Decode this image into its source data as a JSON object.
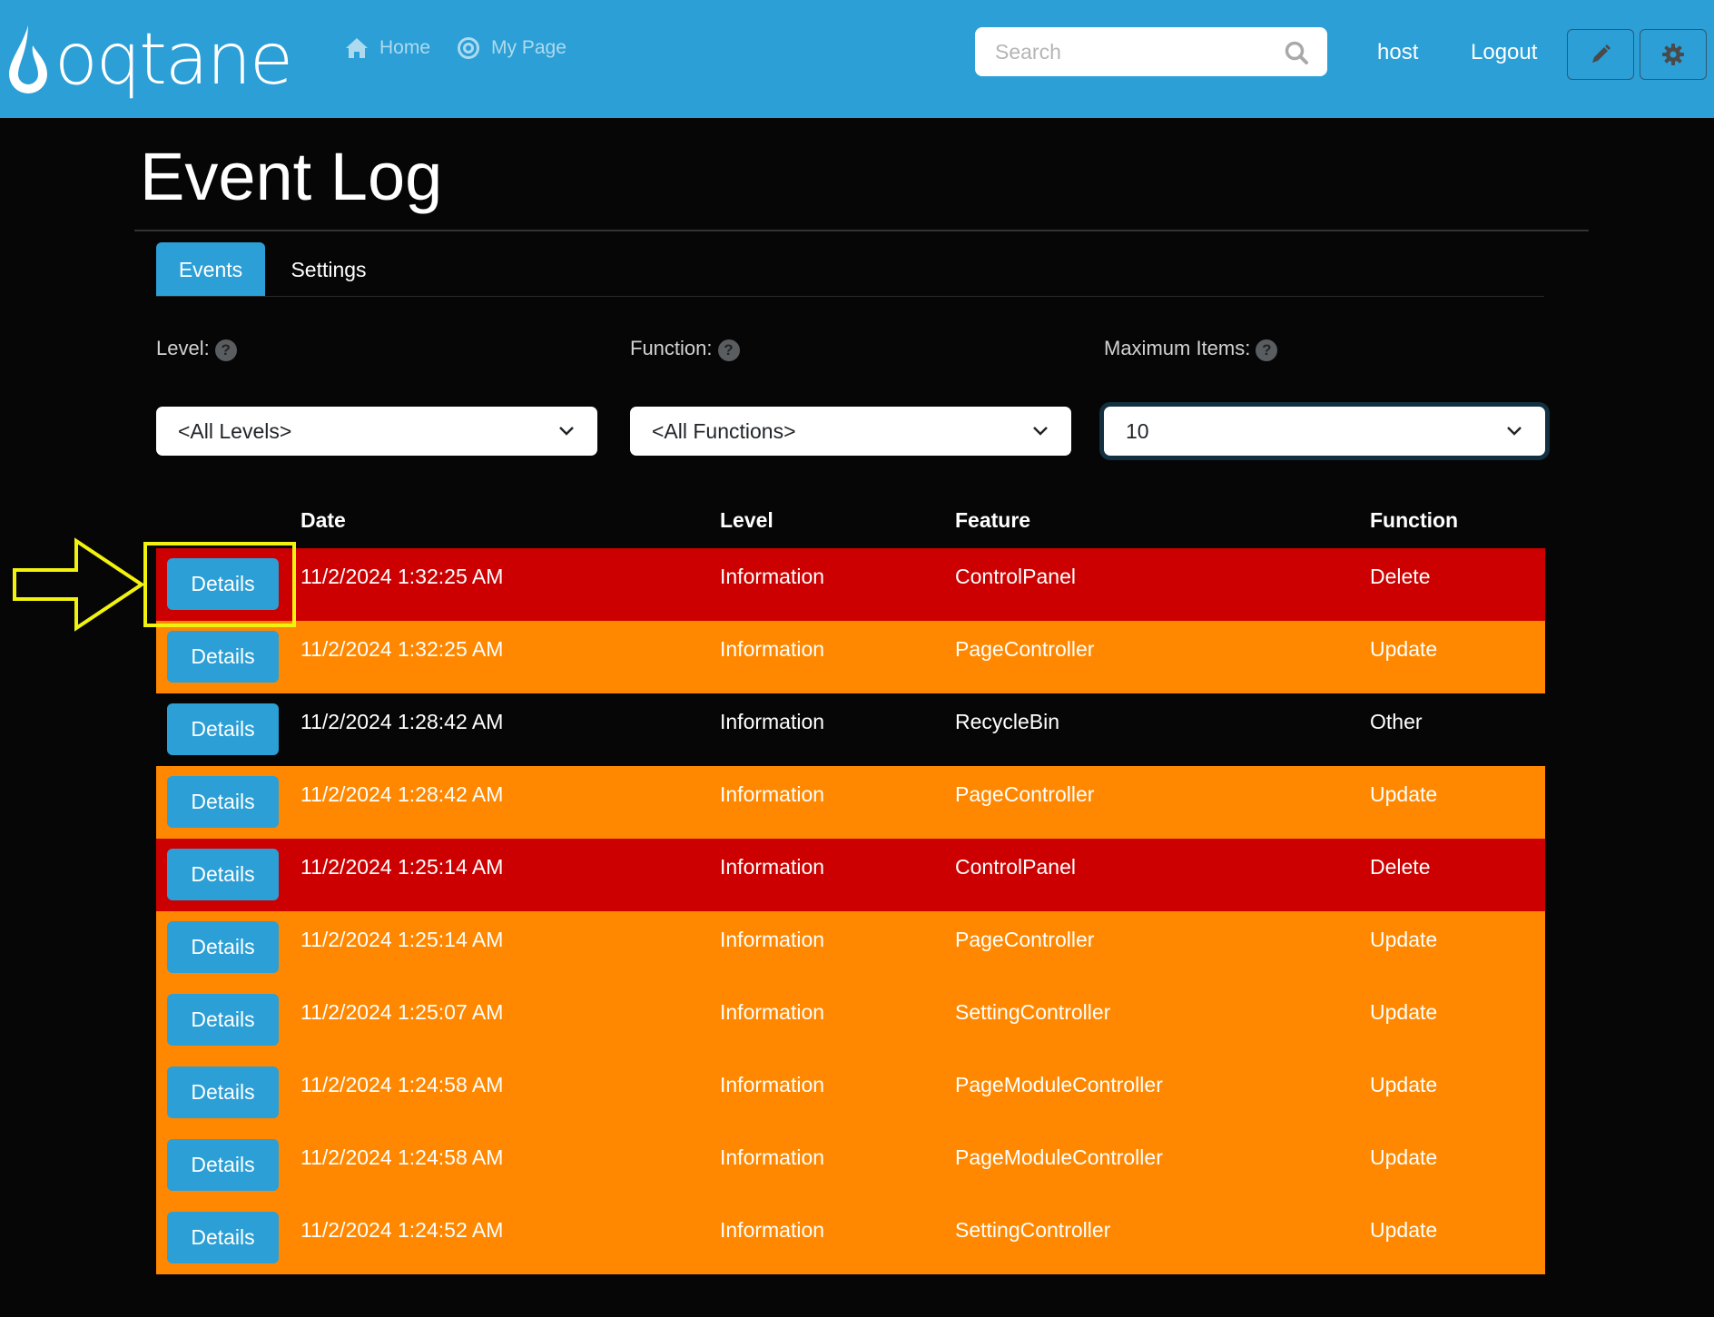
{
  "header": {
    "logo_text": "oqtane",
    "nav": [
      {
        "label": "Home",
        "icon": "home-icon"
      },
      {
        "label": "My Page",
        "icon": "target-icon"
      }
    ],
    "search_placeholder": "Search",
    "user": "host",
    "logout_label": "Logout",
    "edit_icon": "pencil-icon",
    "settings_icon": "gear-icon"
  },
  "page": {
    "title": "Event Log",
    "tabs": [
      {
        "label": "Events",
        "active": true
      },
      {
        "label": "Settings",
        "active": false
      }
    ]
  },
  "filters": {
    "level": {
      "label": "Level:",
      "value": "<All Levels>"
    },
    "function": {
      "label": "Function:",
      "value": "<All Functions>"
    },
    "max_items": {
      "label": "Maximum Items:",
      "value": "10"
    }
  },
  "table": {
    "columns": [
      "",
      "Date",
      "Level",
      "Feature",
      "Function"
    ],
    "button_label": "Details",
    "row_colors": {
      "Delete": "#cc0000",
      "Update": "#ff8800",
      "Other": "#060606"
    },
    "rows": [
      {
        "date": "11/2/2024 1:32:25 AM",
        "level": "Information",
        "feature": "ControlPanel",
        "function": "Delete"
      },
      {
        "date": "11/2/2024 1:32:25 AM",
        "level": "Information",
        "feature": "PageController",
        "function": "Update"
      },
      {
        "date": "11/2/2024 1:28:42 AM",
        "level": "Information",
        "feature": "RecycleBin",
        "function": "Other"
      },
      {
        "date": "11/2/2024 1:28:42 AM",
        "level": "Information",
        "feature": "PageController",
        "function": "Update"
      },
      {
        "date": "11/2/2024 1:25:14 AM",
        "level": "Information",
        "feature": "ControlPanel",
        "function": "Delete"
      },
      {
        "date": "11/2/2024 1:25:14 AM",
        "level": "Information",
        "feature": "PageController",
        "function": "Update"
      },
      {
        "date": "11/2/2024 1:25:07 AM",
        "level": "Information",
        "feature": "SettingController",
        "function": "Update"
      },
      {
        "date": "11/2/2024 1:24:58 AM",
        "level": "Information",
        "feature": "PageModuleController",
        "function": "Update"
      },
      {
        "date": "11/2/2024 1:24:58 AM",
        "level": "Information",
        "feature": "PageModuleController",
        "function": "Update"
      },
      {
        "date": "11/2/2024 1:24:52 AM",
        "level": "Information",
        "feature": "SettingController",
        "function": "Update"
      }
    ]
  },
  "annotation": {
    "color": "#f2f20f",
    "target": "first-row-details-button"
  }
}
